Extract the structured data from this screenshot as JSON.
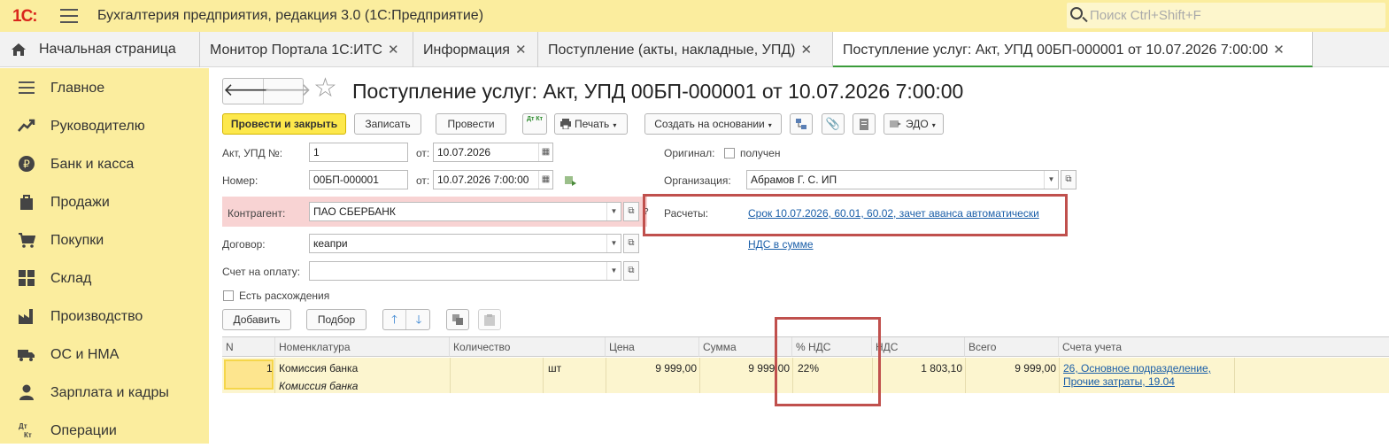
{
  "app": {
    "logo": "1С:",
    "title": "Бухгалтерия предприятия, редакция 3.0  (1С:Предприятие)",
    "search_placeholder": "Поиск Ctrl+Shift+F"
  },
  "tabs": [
    {
      "label": "Начальная страница"
    },
    {
      "label": "Монитор Портала 1С:ИТС"
    },
    {
      "label": "Информация"
    },
    {
      "label": "Поступление (акты, накладные, УПД)"
    },
    {
      "label": "Поступление услуг: Акт, УПД 00БП-000001 от 10.07.2026 7:00:00",
      "active": true
    }
  ],
  "sidebar": [
    {
      "label": "Главное",
      "icon": "menu-icon"
    },
    {
      "label": "Руководителю",
      "icon": "trend-icon"
    },
    {
      "label": "Банк и касса",
      "icon": "ruble-icon"
    },
    {
      "label": "Продажи",
      "icon": "bag-icon"
    },
    {
      "label": "Покупки",
      "icon": "cart-icon"
    },
    {
      "label": "Склад",
      "icon": "warehouse-icon"
    },
    {
      "label": "Производство",
      "icon": "factory-icon"
    },
    {
      "label": "ОС и НМА",
      "icon": "truck-icon"
    },
    {
      "label": "Зарплата и кадры",
      "icon": "person-icon"
    },
    {
      "label": "Операции",
      "icon": "dt-kt-icon"
    }
  ],
  "document": {
    "title": "Поступление услуг: Акт, УПД 00БП-000001 от 10.07.2026 7:00:00",
    "toolbar": {
      "post_close": "Провести и закрыть",
      "save": "Записать",
      "post": "Провести",
      "dt_kt": "Дт Кт",
      "print": "Печать",
      "create_based": "Создать на основании",
      "edo": "ЭДО"
    },
    "labels": {
      "act_no": "Акт, УПД №:",
      "from": "от:",
      "number": "Номер:",
      "original": "Оригинал:",
      "received": "получен",
      "organization": "Организация:",
      "counterparty": "Контрагент:",
      "settlements": "Расчеты:",
      "contract": "Договор:",
      "invoice_account": "Счет на оплату:",
      "discrepancies": "Есть расхождения",
      "question": "?"
    },
    "values": {
      "act_no": "1",
      "act_date": "10.07.2026",
      "number": "00БП-000001",
      "number_date": "10.07.2026  7:00:00",
      "organization": "Абрамов Г. С. ИП",
      "counterparty": "ПАО СБЕРБАНК",
      "contract": "кеапри",
      "invoice_account": ""
    },
    "links": {
      "settlements": "Срок 10.07.2026, 60.01, 60.02, зачет аванса автоматически",
      "vat_in_sum": "НДС в сумме"
    },
    "table_toolbar": {
      "add": "Добавить",
      "pick": "Подбор"
    },
    "table": {
      "columns": [
        "N",
        "Номенклатура",
        "Количество",
        "Цена",
        "Сумма",
        "% НДС",
        "НДС",
        "Всего",
        "Счета учета"
      ],
      "rows": [
        {
          "n": "1",
          "item": "Комиссия банка",
          "item_sub": "Комиссия банка",
          "unit": "шт",
          "price": "9 999,00",
          "sum": "9 999,00",
          "vat_rate": "22%",
          "vat": "1 803,10",
          "total": "9 999,00",
          "accounts_line1": "26, Основное подразделение,",
          "accounts_line2": "Прочие затраты, 19.04"
        }
      ]
    }
  },
  "colors": {
    "sidebar_bg": "#fbed9e",
    "primary_button": "#fde84c",
    "highlight_box": "#c0504d",
    "link": "#1a5ea8",
    "row_bg": "#fcf5cf"
  }
}
